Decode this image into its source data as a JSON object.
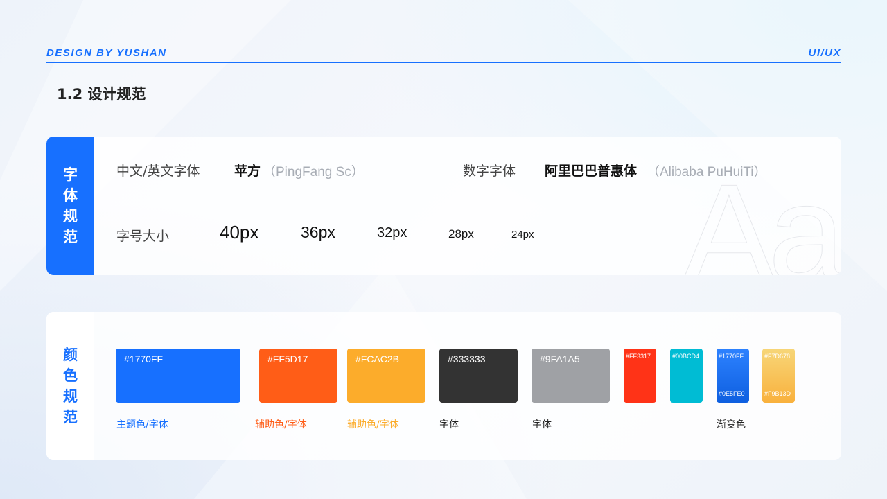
{
  "header": {
    "brand": "DESIGN BY YUSHAN",
    "tag": "UI/UX"
  },
  "page_title": "1.2 设计规范",
  "font_section": {
    "side_label": "字体规范",
    "cn_en_font_label": "中文/英文字体",
    "cn_en_font_name": "苹方",
    "cn_en_font_en": "（PingFang Sc）",
    "number_font_label": "数字字体",
    "number_font_name": "阿里巴巴普惠体",
    "number_font_en": "（Alibaba PuHuiTi）",
    "size_label": "字号大小",
    "sizes": [
      "40px",
      "36px",
      "32px",
      "28px",
      "24px"
    ],
    "watermark": "Aa"
  },
  "color_section": {
    "side_label": "颜色规范",
    "swatches": [
      {
        "hex": "#1770FF",
        "color": "#1770ff",
        "caption": "主题色/字体",
        "caption_color": "#1770ff"
      },
      {
        "hex": "#FF5D17",
        "color": "#ff5d17",
        "caption": "辅助色/字体",
        "caption_color": "#ff5d17"
      },
      {
        "hex": "#FCAC2B",
        "color": "#fcac2b",
        "caption": "辅助色/字体",
        "caption_color": "#fcac2b"
      },
      {
        "hex": "#333333",
        "color": "#333333",
        "caption": "字体",
        "caption_color": "#222222"
      },
      {
        "hex": "#9FA1A5",
        "color": "#9fa1a5",
        "caption": "字体",
        "caption_color": "#222222"
      }
    ],
    "small_swatches": [
      {
        "hex": "#FF3317",
        "color": "#ff3317"
      },
      {
        "hex": "#00BCD4",
        "color": "#00bcd4"
      }
    ],
    "gradients": [
      {
        "top_hex": "#1770FF",
        "bottom_hex": "#0E5FE0",
        "from": "#1770ff",
        "to": "#0e5fe0"
      },
      {
        "top_hex": "#F7D678",
        "bottom_hex": "#F9B13D",
        "from": "#f7d678",
        "to": "#f9b13d"
      }
    ],
    "gradient_caption": "渐变色"
  }
}
